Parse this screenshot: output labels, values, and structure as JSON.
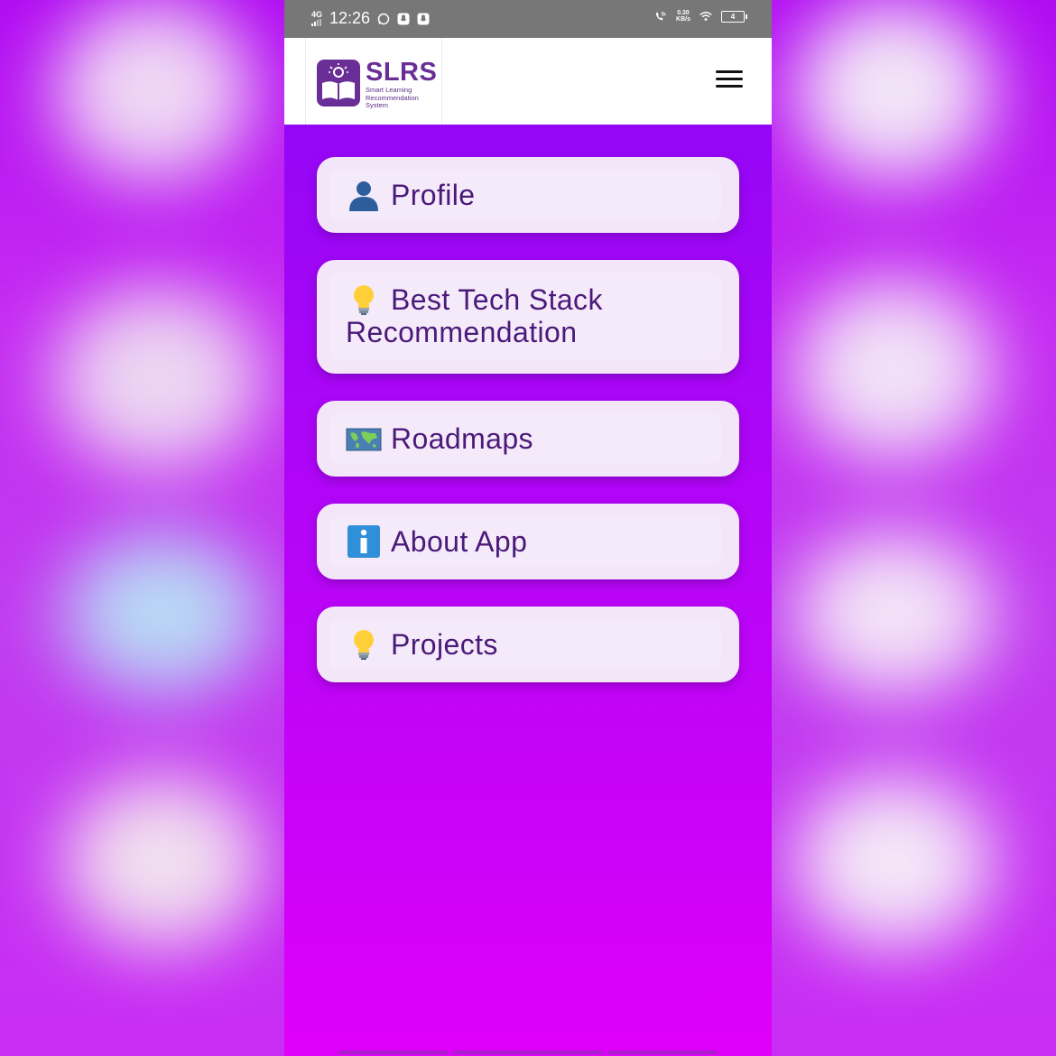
{
  "status_bar": {
    "network": "4G",
    "time": "12:26",
    "speed_value": "0.30",
    "speed_unit": "KB/s",
    "battery": "4"
  },
  "header": {
    "logo_title": "SLRS",
    "logo_subtitle_line1": "Smart Learning",
    "logo_subtitle_line2": "Recommendation",
    "logo_subtitle_line3": "System"
  },
  "menu": {
    "items": [
      {
        "icon": "person-icon",
        "label": "Profile"
      },
      {
        "icon": "lightbulb-icon",
        "label_line1": "Best Tech Stack",
        "label_line2": "Recommendation"
      },
      {
        "icon": "world-map-icon",
        "label": "Roadmaps"
      },
      {
        "icon": "info-icon",
        "label": "About App"
      },
      {
        "icon": "lightbulb-icon",
        "label": "Projects"
      }
    ]
  },
  "colors": {
    "accent": "#6a2f97",
    "card_bg": "#f3e6f8",
    "text": "#4a1a7a",
    "status_bar": "#777777"
  }
}
